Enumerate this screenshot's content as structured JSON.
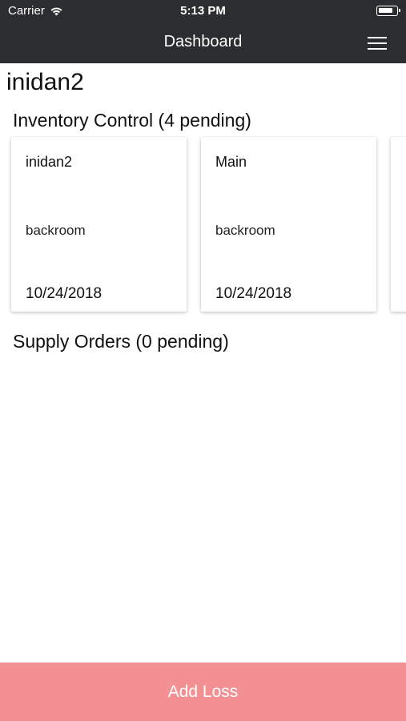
{
  "status_bar": {
    "carrier": "Carrier",
    "time": "5:13 PM",
    "icons": [
      "wifi-icon",
      "battery-icon"
    ]
  },
  "nav": {
    "title": "Dashboard",
    "menu_icon": "hamburger-menu-icon"
  },
  "page_title": "inidan2",
  "inventory": {
    "title": "Inventory Control (4 pending)",
    "cards": [
      {
        "name": "inidan2",
        "location": "backroom",
        "date": "10/24/2018"
      },
      {
        "name": "Main",
        "location": "backroom",
        "date": "10/24/2018"
      }
    ]
  },
  "supply": {
    "title": "Supply Orders (0 pending)"
  },
  "footer": {
    "add_loss_label": "Add Loss"
  },
  "colors": {
    "nav_bg": "#2b2d2f",
    "button_bg": "#f39093",
    "button_text": "#ffffff"
  }
}
